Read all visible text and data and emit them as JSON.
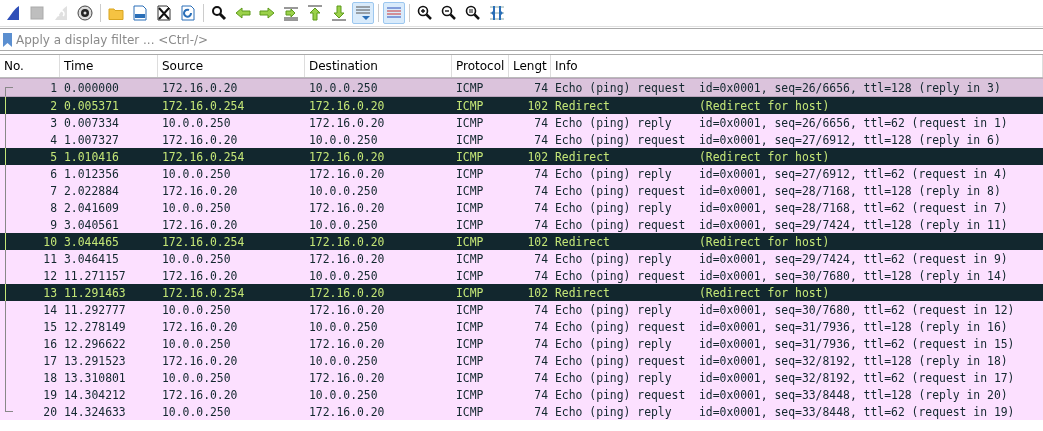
{
  "toolbar": [
    [
      {
        "kind": "start",
        "disabled": false,
        "on": false
      },
      {
        "kind": "stop",
        "disabled": true,
        "on": false
      },
      {
        "kind": "restart",
        "disabled": true,
        "on": false
      },
      {
        "kind": "options",
        "disabled": false,
        "on": false
      }
    ],
    [
      {
        "kind": "open",
        "disabled": false,
        "on": false
      },
      {
        "kind": "save",
        "disabled": false,
        "on": false
      },
      {
        "kind": "close",
        "disabled": false,
        "on": false
      },
      {
        "kind": "reload",
        "disabled": false,
        "on": false
      }
    ],
    [
      {
        "kind": "find",
        "disabled": false,
        "on": false
      },
      {
        "kind": "back",
        "disabled": false,
        "on": false
      },
      {
        "kind": "forward",
        "disabled": false,
        "on": false
      },
      {
        "kind": "goto",
        "disabled": false,
        "on": false
      },
      {
        "kind": "first",
        "disabled": false,
        "on": false
      },
      {
        "kind": "last",
        "disabled": false,
        "on": false
      },
      {
        "kind": "autoscroll",
        "disabled": false,
        "on": true
      }
    ],
    [
      {
        "kind": "colorize",
        "disabled": false,
        "on": true
      }
    ],
    [
      {
        "kind": "zoom_in",
        "disabled": false,
        "on": false
      },
      {
        "kind": "zoom_out",
        "disabled": false,
        "on": false
      },
      {
        "kind": "zoom_normal",
        "disabled": false,
        "on": false
      },
      {
        "kind": "resize_columns",
        "disabled": false,
        "on": false
      }
    ]
  ],
  "filter": {
    "placeholder": "Apply a display filter ... <Ctrl-/>"
  },
  "packet_list": {
    "columns": [
      "No.",
      "Time",
      "Source",
      "Destination",
      "Protocol",
      "Lengt",
      "Info"
    ],
    "rows": [
      {
        "kind": "echo",
        "selected": true,
        "cells": [
          "1",
          "0.000000",
          "172.16.0.20",
          "10.0.0.250",
          "ICMP",
          "74",
          "Echo (ping) request  id=0x0001, seq=26/6656, ttl=128 (reply in 3)"
        ]
      },
      {
        "kind": "redirect",
        "selected": false,
        "cells": [
          "2",
          "0.005371",
          "172.16.0.254",
          "172.16.0.20",
          "ICMP",
          "102",
          "Redirect             (Redirect for host)"
        ]
      },
      {
        "kind": "echo",
        "selected": false,
        "cells": [
          "3",
          "0.007334",
          "10.0.0.250",
          "172.16.0.20",
          "ICMP",
          "74",
          "Echo (ping) reply    id=0x0001, seq=26/6656, ttl=62 (request in 1)"
        ]
      },
      {
        "kind": "echo",
        "selected": false,
        "cells": [
          "4",
          "1.007327",
          "172.16.0.20",
          "10.0.0.250",
          "ICMP",
          "74",
          "Echo (ping) request  id=0x0001, seq=27/6912, ttl=128 (reply in 6)"
        ]
      },
      {
        "kind": "redirect",
        "selected": false,
        "cells": [
          "5",
          "1.010416",
          "172.16.0.254",
          "172.16.0.20",
          "ICMP",
          "102",
          "Redirect             (Redirect for host)"
        ]
      },
      {
        "kind": "echo",
        "selected": false,
        "cells": [
          "6",
          "1.012356",
          "10.0.0.250",
          "172.16.0.20",
          "ICMP",
          "74",
          "Echo (ping) reply    id=0x0001, seq=27/6912, ttl=62 (request in 4)"
        ]
      },
      {
        "kind": "echo",
        "selected": false,
        "cells": [
          "7",
          "2.022884",
          "172.16.0.20",
          "10.0.0.250",
          "ICMP",
          "74",
          "Echo (ping) request  id=0x0001, seq=28/7168, ttl=128 (reply in 8)"
        ]
      },
      {
        "kind": "echo",
        "selected": false,
        "cells": [
          "8",
          "2.041609",
          "10.0.0.250",
          "172.16.0.20",
          "ICMP",
          "74",
          "Echo (ping) reply    id=0x0001, seq=28/7168, ttl=62 (request in 7)"
        ]
      },
      {
        "kind": "echo",
        "selected": false,
        "cells": [
          "9",
          "3.040561",
          "172.16.0.20",
          "10.0.0.250",
          "ICMP",
          "74",
          "Echo (ping) request  id=0x0001, seq=29/7424, ttl=128 (reply in 11)"
        ]
      },
      {
        "kind": "redirect",
        "selected": false,
        "cells": [
          "10",
          "3.044465",
          "172.16.0.254",
          "172.16.0.20",
          "ICMP",
          "102",
          "Redirect             (Redirect for host)"
        ]
      },
      {
        "kind": "echo",
        "selected": false,
        "cells": [
          "11",
          "3.046415",
          "10.0.0.250",
          "172.16.0.20",
          "ICMP",
          "74",
          "Echo (ping) reply    id=0x0001, seq=29/7424, ttl=62 (request in 9)"
        ]
      },
      {
        "kind": "echo",
        "selected": false,
        "cells": [
          "12",
          "11.271157",
          "172.16.0.20",
          "10.0.0.250",
          "ICMP",
          "74",
          "Echo (ping) request  id=0x0001, seq=30/7680, ttl=128 (reply in 14)"
        ]
      },
      {
        "kind": "redirect",
        "selected": false,
        "cells": [
          "13",
          "11.291463",
          "172.16.0.254",
          "172.16.0.20",
          "ICMP",
          "102",
          "Redirect             (Redirect for host)"
        ]
      },
      {
        "kind": "echo",
        "selected": false,
        "cells": [
          "14",
          "11.292777",
          "10.0.0.250",
          "172.16.0.20",
          "ICMP",
          "74",
          "Echo (ping) reply    id=0x0001, seq=30/7680, ttl=62 (request in 12)"
        ]
      },
      {
        "kind": "echo",
        "selected": false,
        "cells": [
          "15",
          "12.278149",
          "172.16.0.20",
          "10.0.0.250",
          "ICMP",
          "74",
          "Echo (ping) request  id=0x0001, seq=31/7936, ttl=128 (reply in 16)"
        ]
      },
      {
        "kind": "echo",
        "selected": false,
        "cells": [
          "16",
          "12.296622",
          "10.0.0.250",
          "172.16.0.20",
          "ICMP",
          "74",
          "Echo (ping) reply    id=0x0001, seq=31/7936, ttl=62 (request in 15)"
        ]
      },
      {
        "kind": "echo",
        "selected": false,
        "cells": [
          "17",
          "13.291523",
          "172.16.0.20",
          "10.0.0.250",
          "ICMP",
          "74",
          "Echo (ping) request  id=0x0001, seq=32/8192, ttl=128 (reply in 18)"
        ]
      },
      {
        "kind": "echo",
        "selected": false,
        "cells": [
          "18",
          "13.310801",
          "10.0.0.250",
          "172.16.0.20",
          "ICMP",
          "74",
          "Echo (ping) reply    id=0x0001, seq=32/8192, ttl=62 (request in 17)"
        ]
      },
      {
        "kind": "echo",
        "selected": false,
        "cells": [
          "19",
          "14.304212",
          "172.16.0.20",
          "10.0.0.250",
          "ICMP",
          "74",
          "Echo (ping) request  id=0x0001, seq=33/8448, ttl=128 (reply in 20)"
        ]
      },
      {
        "kind": "echo",
        "selected": false,
        "cells": [
          "20",
          "14.324633",
          "10.0.0.250",
          "172.16.0.20",
          "ICMP",
          "74",
          "Echo (ping) reply    id=0x0001, seq=33/8448, ttl=62 (request in 19)"
        ]
      }
    ]
  }
}
